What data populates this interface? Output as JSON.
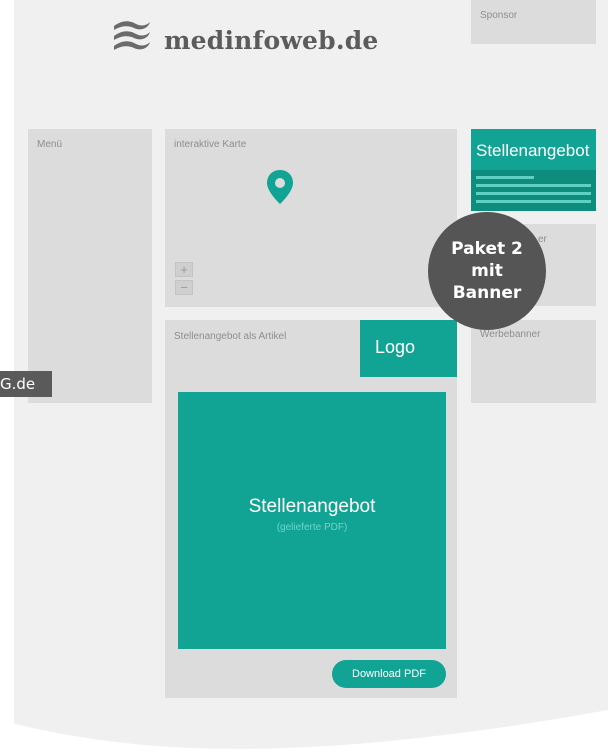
{
  "site": {
    "name": "medinfoweb.de"
  },
  "sponsor": {
    "label": "Sponsor"
  },
  "menu": {
    "label": "Menü"
  },
  "map": {
    "label": "interaktive Karte",
    "zoom_in": "+",
    "zoom_out": "−"
  },
  "job_sidebar": {
    "title": "Stellenangebot"
  },
  "badge": {
    "line1": "Paket 2",
    "line2": "mit",
    "line3": "Banner"
  },
  "banner_hidden": {
    "label_fragment": "er"
  },
  "werbebanner": {
    "label": "Werbebanner"
  },
  "article": {
    "label": "Stellenangebot als Artikel",
    "logo": "Logo",
    "pdf_title": "Stellenangebot",
    "pdf_subtitle": "(gelieferte PDF)",
    "download_button": "Download PDF"
  },
  "watermark": {
    "text": "G.de"
  },
  "colors": {
    "accent": "#11a393",
    "badge": "#555555",
    "placeholder": "#dcdcdc",
    "page": "#f0f0f0"
  },
  "icons": {
    "logo": "waves-logo-icon",
    "map_marker": "map-pin-icon"
  }
}
